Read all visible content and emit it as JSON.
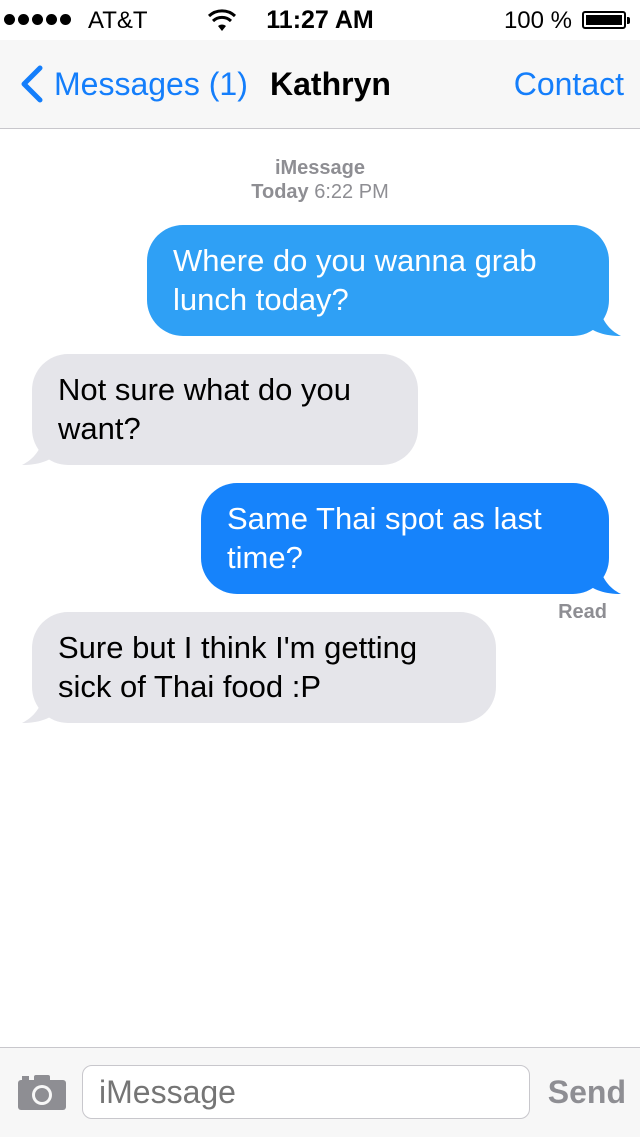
{
  "status_bar": {
    "carrier": "AT&T",
    "time": "11:27 AM",
    "battery": "100 %",
    "signal_icon": "signal-dots-icon",
    "wifi_icon": "wifi-icon",
    "battery_icon": "battery-icon",
    "battery_level": 1.0
  },
  "nav": {
    "back_label": "Messages (1)",
    "title": "Kathryn",
    "contact_label": "Contact"
  },
  "thread": {
    "service": "iMessage",
    "date_label": "Today",
    "time_label": "6:22 PM",
    "read_receipt": "Read",
    "messages": [
      {
        "direction": "outgoing",
        "text": "Where do you wanna grab lunch today?",
        "color": "#2fa0f5"
      },
      {
        "direction": "incoming",
        "text": "Not sure what do you want?",
        "color": "#e5e5ea"
      },
      {
        "direction": "outgoing",
        "text": "Same Thai spot as last time?",
        "color": "#1683fb"
      },
      {
        "direction": "incoming",
        "text": "Sure but I think I'm getting sick of Thai food :P",
        "color": "#e5e5ea"
      }
    ]
  },
  "compose": {
    "placeholder": "iMessage",
    "send_label": "Send",
    "camera_icon": "camera-icon"
  },
  "colors": {
    "accent": "#147efb",
    "secondary_text": "#8e8e93"
  }
}
